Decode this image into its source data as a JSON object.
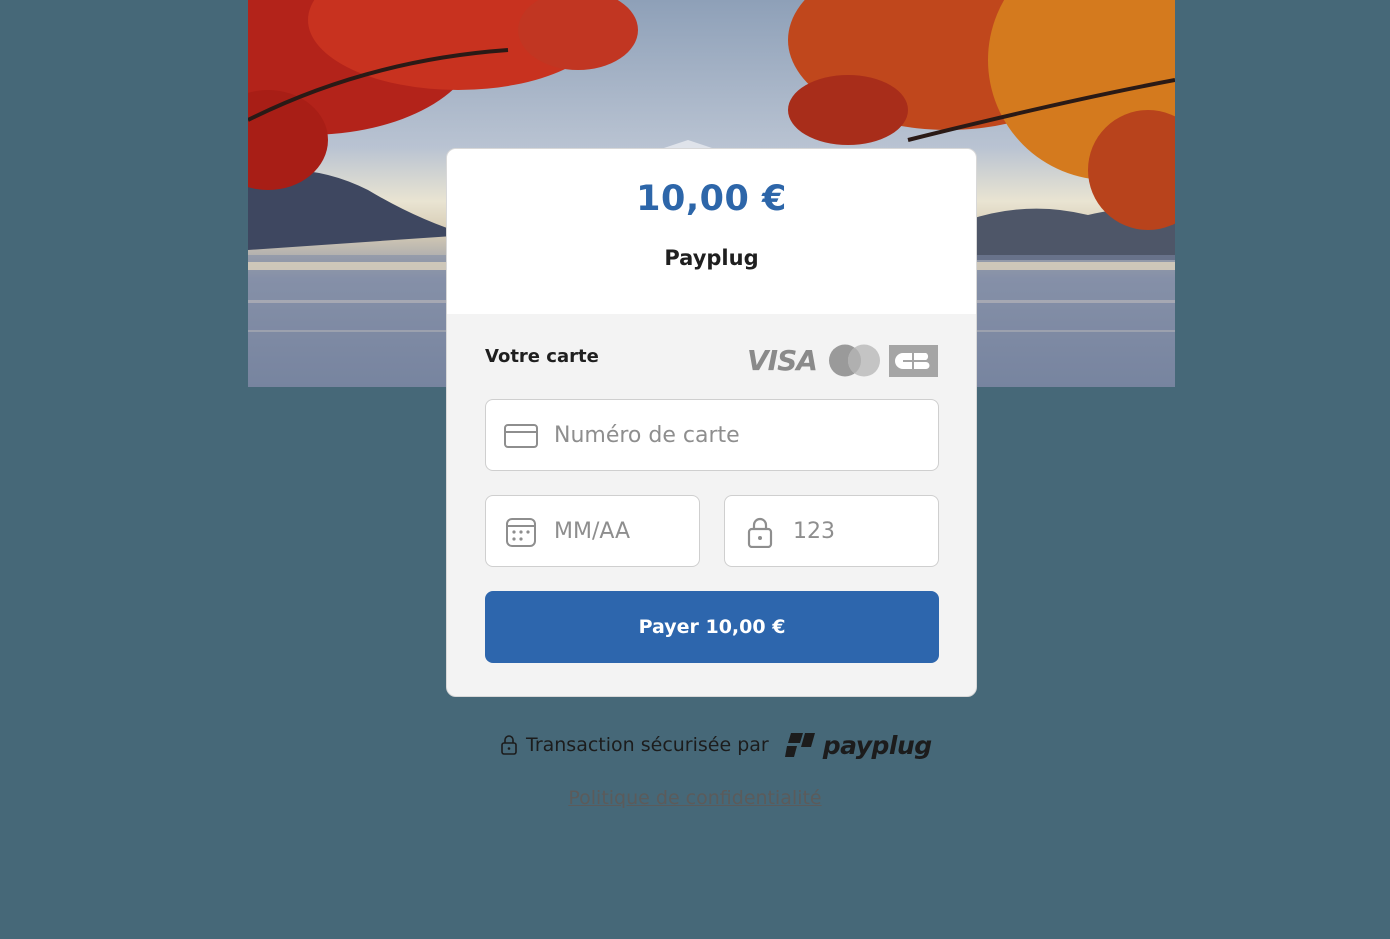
{
  "checkout": {
    "amount": "10,00 €",
    "merchant": "Payplug"
  },
  "card_form": {
    "label": "Votre carte",
    "brands": {
      "visa": "VISA",
      "cb": "CB"
    },
    "card_number_placeholder": "Numéro de carte",
    "expiry_placeholder": "MM/AA",
    "cvc_placeholder": "123",
    "pay_button_label": "Payer 10,00 €"
  },
  "footer": {
    "secure_text": "Transaction sécurisée par",
    "brand_name": "payplug",
    "privacy_link": "Politique de confidentialité"
  },
  "colors": {
    "page_background": "#466878",
    "accent": "#2d66ad",
    "amount_text": "#2d66a9"
  },
  "icons": [
    "credit-card-icon",
    "calendar-icon",
    "lock-icon",
    "visa-logo",
    "mastercard-logo",
    "cb-logo",
    "payplug-logo"
  ]
}
